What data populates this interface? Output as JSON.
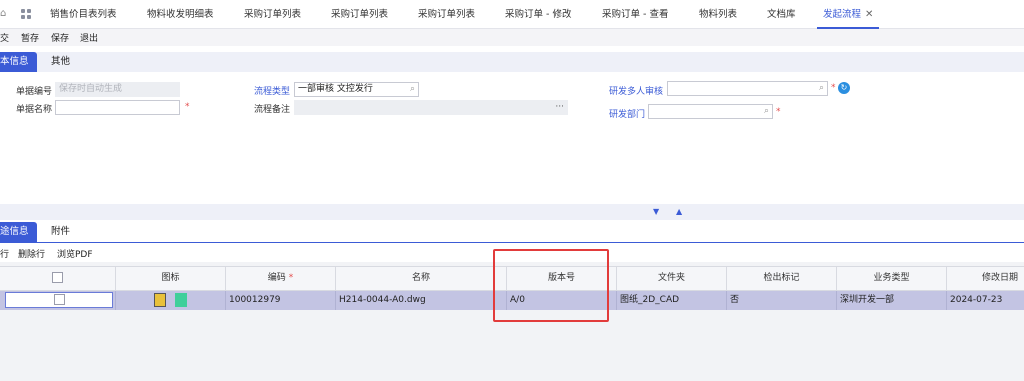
{
  "tabs": [
    {
      "label": "销售价目表列表"
    },
    {
      "label": "物料收发明细表"
    },
    {
      "label": "采购订单列表"
    },
    {
      "label": "采购订单列表"
    },
    {
      "label": "采购订单列表"
    },
    {
      "label": "采购订单 - 修改"
    },
    {
      "label": "采购订单 - 查看"
    },
    {
      "label": "物料列表"
    },
    {
      "label": "文档库"
    },
    {
      "label": "发起流程",
      "close": "✕"
    }
  ],
  "toolbar": {
    "submit": "交",
    "stage": "暂存",
    "save": "保存",
    "exit": "退出"
  },
  "header_tabs": {
    "basic": "本信息",
    "other": "其他"
  },
  "form": {
    "doc_no_label": "单据编号",
    "doc_no_placeholder": "保存时自动生成",
    "doc_name_label": "单据名称",
    "flow_type_label": "流程类型",
    "flow_type_value": "一部审核 文控发行",
    "flow_remark_label": "流程备注",
    "flow_remark_more": "···",
    "rd_review_label": "研发多人审核",
    "rd_dept_label": "研发部门",
    "required_mark": "*"
  },
  "detail_tabs": {
    "docs": "途信息",
    "attach": "附件"
  },
  "detail_toolbar": {
    "add": "行",
    "delete": "删除行",
    "preview": "浏览PDF"
  },
  "table": {
    "headers": [
      "图标",
      "编码",
      "名称",
      "版本号",
      "文件夹",
      "检出标记",
      "业务类型",
      "修改日期"
    ],
    "code_required": "*",
    "rows": [
      {
        "code": "100012979",
        "name": "H214-0044-A0.dwg",
        "version": "A/0",
        "folder": "图纸_2D_CAD",
        "checkout": "否",
        "biz_type": "深圳开发一部",
        "modified": "2024-07-23"
      }
    ]
  },
  "colors": {
    "accent": "#3b5bd6",
    "selected_row": "#c3c4e3",
    "highlight": "#e23b3b"
  }
}
